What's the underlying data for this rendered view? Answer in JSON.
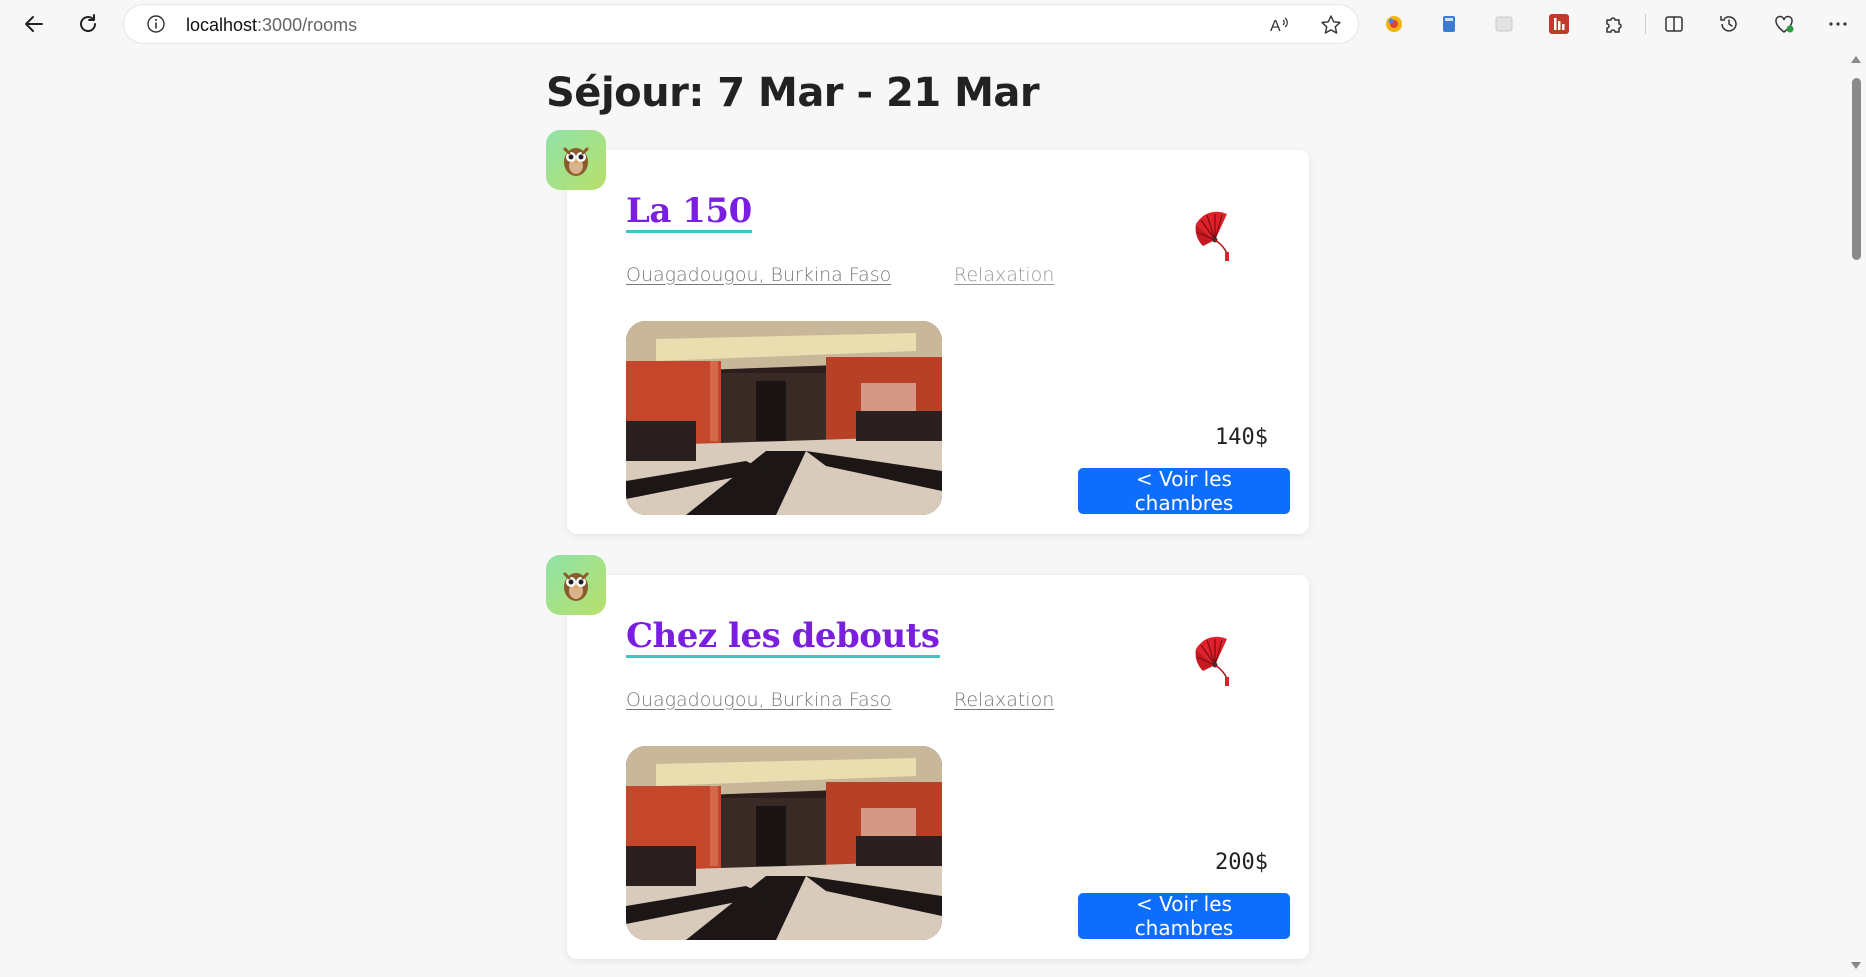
{
  "browser": {
    "url_host": "localhost",
    "url_path": ":3000/rooms",
    "icons": {
      "back": "back-arrow-icon",
      "reload": "reload-icon",
      "info": "info-icon",
      "read_aloud": "read-aloud-icon",
      "favorite": "star-icon",
      "extensions": "puzzle-icon",
      "split": "split-screen-icon",
      "history": "history-icon",
      "health": "browser-essentials-icon",
      "menu": "more-icon"
    }
  },
  "page": {
    "title": "Séjour: 7 Mar - 21 Mar"
  },
  "hotels": [
    {
      "name": "La 150",
      "location": "Ouagadougou, Burkina Faso",
      "category": "Relaxation",
      "price": "140$",
      "button_label": "< Voir les chambres",
      "badge_icon": "owl-icon",
      "category_icon": "fan-icon"
    },
    {
      "name": "Chez les debouts",
      "location": "Ouagadougou, Burkina Faso",
      "category": "Relaxation",
      "price": "200$",
      "button_label": "< Voir les chambres",
      "badge_icon": "owl-icon",
      "category_icon": "fan-icon"
    }
  ],
  "colors": {
    "accent_button": "#0d6efd",
    "hotel_name": "#7a1fe0",
    "name_underline": "#3dc4c4"
  }
}
